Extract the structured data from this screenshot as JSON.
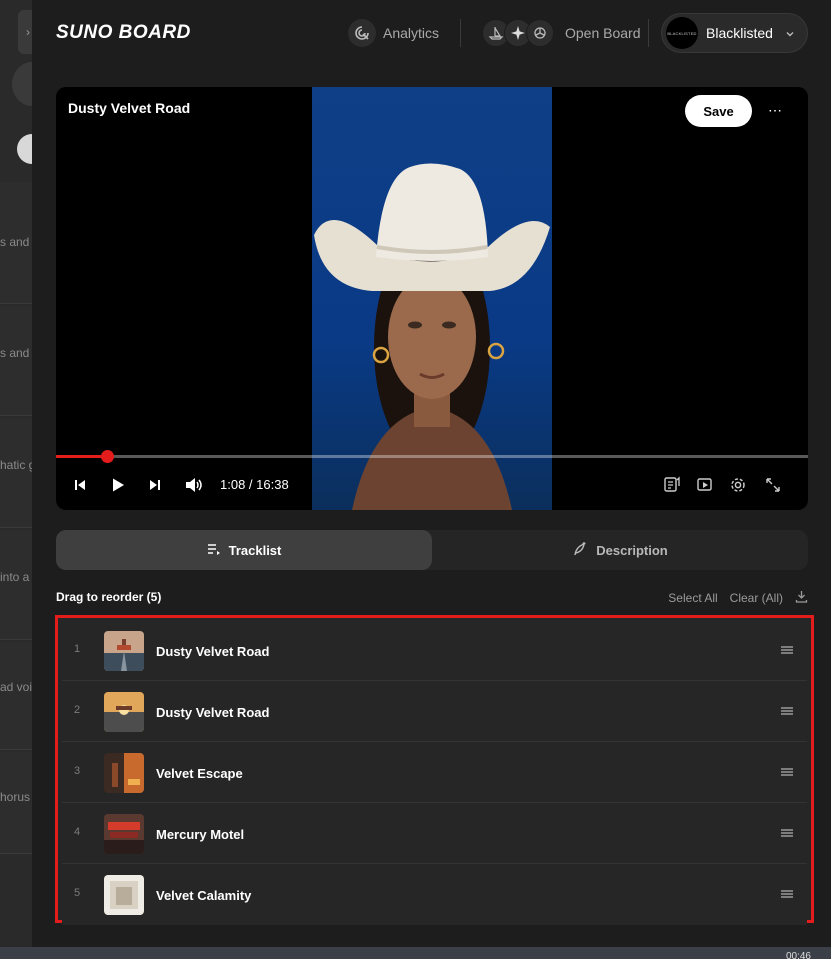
{
  "header": {
    "logo": "SUNO BOARD",
    "analytics_label": "Analytics",
    "openboard_label": "Open Board",
    "profile_name": "Blacklisted",
    "avatar_text": "BLACKLISTED"
  },
  "player": {
    "title": "Dusty Velvet Road",
    "save_label": "Save",
    "more_label": "⋯",
    "time": "1:08 / 16:38",
    "progress_fraction": 0.068
  },
  "tabs": [
    {
      "label": "Tracklist",
      "active": true
    },
    {
      "label": "Description",
      "active": false
    }
  ],
  "tracklist": {
    "count_label": "Drag to reorder (5)",
    "select_all": "Select All",
    "clear_all": "Clear (All)",
    "tracks": [
      {
        "number": "1",
        "title": "Dusty Velvet Road"
      },
      {
        "number": "2",
        "title": "Dusty Velvet Road"
      },
      {
        "number": "3",
        "title": "Velvet Escape"
      },
      {
        "number": "4",
        "title": "Mercury Motel"
      },
      {
        "number": "5",
        "title": "Velvet Calamity"
      }
    ]
  },
  "background_page": {
    "snippets": [
      "s and a",
      "s and a",
      "hatic g",
      "into a l",
      "ad voic",
      "horus c"
    ]
  },
  "taskbar": {
    "clock": "00:46"
  },
  "colors": {
    "accent": "#e41c1c",
    "panel": "#1d1d1d",
    "row": "#262626"
  }
}
